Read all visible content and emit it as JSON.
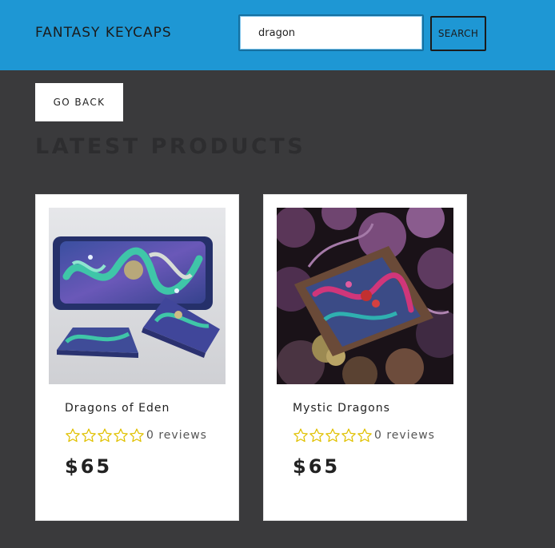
{
  "header": {
    "brand": "FANTASY KEYCAPS",
    "search": {
      "value": "dragon",
      "button_label": "SEARCH"
    }
  },
  "nav": {
    "back_label": "GO BACK"
  },
  "main": {
    "title": "LATEST PRODUCTS",
    "products": [
      {
        "name": "Dragons of Eden",
        "stars": 0,
        "reviews": "0 reviews",
        "price": "$65",
        "image_icon": "dragon-keycap-image"
      },
      {
        "name": "Mystic Dragons",
        "stars": 0,
        "reviews": "0 reviews",
        "price": "$65",
        "image_icon": "dragon-keycap-image"
      }
    ]
  },
  "colors": {
    "header_bg": "#1e97d4",
    "page_bg": "#3a3a3c",
    "star": "#e0c100"
  }
}
